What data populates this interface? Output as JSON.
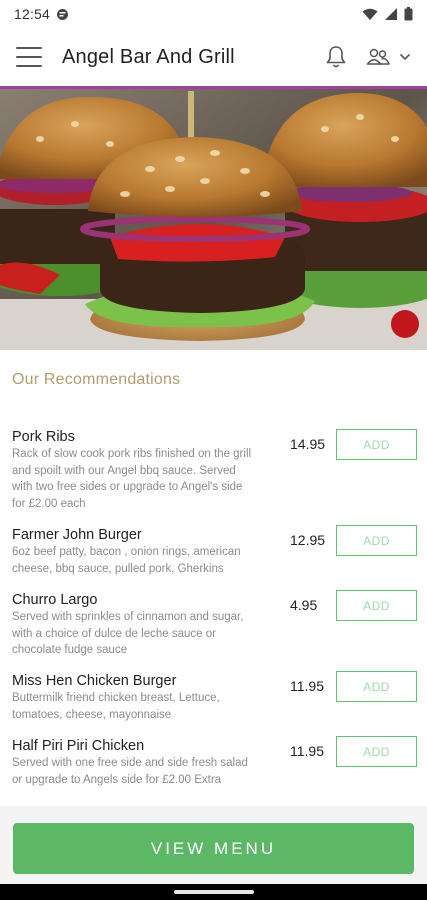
{
  "status_bar": {
    "time": "12:54",
    "icons": [
      "notification-icon",
      "wifi-icon",
      "signal-icon",
      "battery-icon"
    ]
  },
  "app_bar": {
    "title": "Angel Bar And Grill",
    "icons": [
      "menu-icon",
      "bell-icon",
      "people-icon",
      "chevron-down-icon"
    ]
  },
  "colors": {
    "accent_line": "#a23fa0",
    "add_border": "#5cc46e",
    "view_menu_bg": "#5cb865",
    "section_title": "#b39b6e"
  },
  "hero": {
    "image": "burger-photo"
  },
  "recommendations": {
    "title": "Our Recommendations",
    "items": [
      {
        "name": "Pork Ribs",
        "desc_lines": [
          "Rack of slow cook pork ribs finished on the grill",
          "and spoilt with our Angel bbq sauce. Served",
          "with two free sides or upgrade to Angel's side",
          "for £2.00 each"
        ],
        "price": "14.95",
        "add_label": "ADD"
      },
      {
        "name": "Farmer John Burger",
        "desc_lines": [
          "6oz beef patty, bacon , onion rings, american",
          "cheese, bbq sauce, pulled pork, Gherkins"
        ],
        "price": "12.95",
        "add_label": "ADD"
      },
      {
        "name": "Churro Largo",
        "desc_lines": [
          "Served with sprinkles of cinnamon and sugar,",
          "with a choice of dulce de leche sauce or",
          "chocolate fudge sauce"
        ],
        "price": "4.95",
        "add_label": "ADD"
      },
      {
        "name": "Miss Hen Chicken Burger",
        "desc_lines": [
          "Buttermilk friend chicken breast, Lettuce,",
          "tomatoes, cheese, mayonnaise"
        ],
        "price": "11.95",
        "add_label": "ADD"
      },
      {
        "name": "Half Piri Piri Chicken",
        "desc_lines": [
          "Served with one free side and side fresh salad",
          "or upgrade to Angels side for £2.00 Extra"
        ],
        "price": "11.95",
        "add_label": "ADD"
      }
    ]
  },
  "footer": {
    "view_menu_label": "VIEW MENU"
  }
}
